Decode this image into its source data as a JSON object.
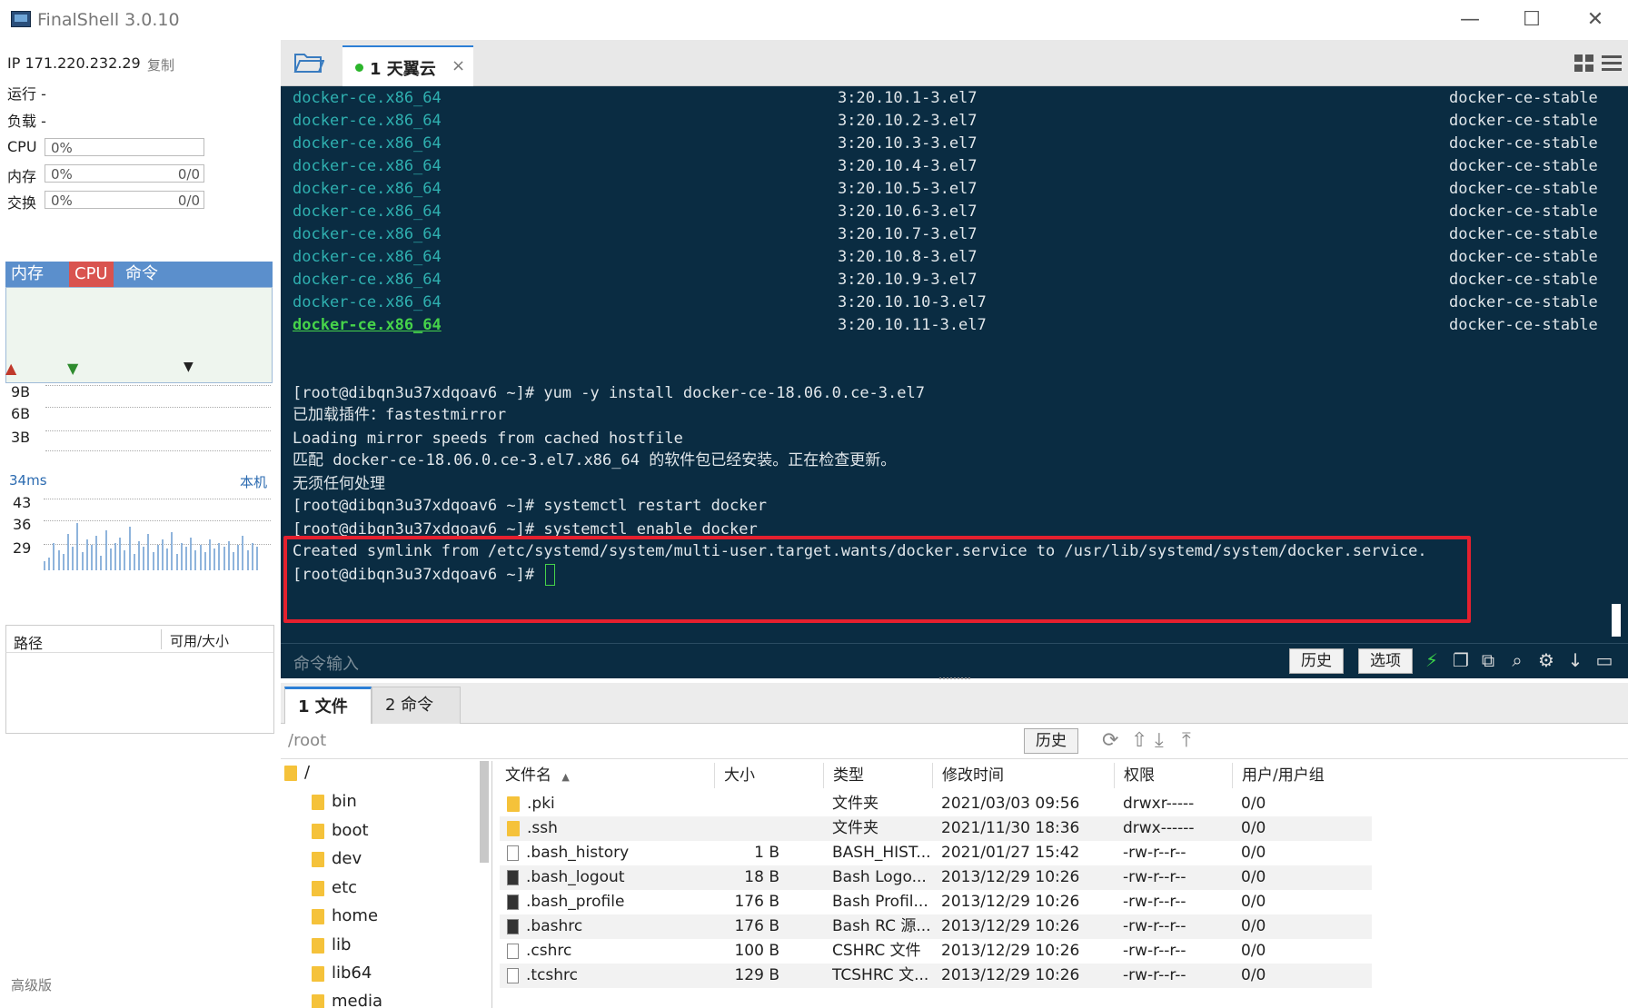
{
  "window": {
    "title": "FinalShell 3.0.10",
    "min": "—",
    "max": "☐",
    "close": "✕"
  },
  "sidebar": {
    "ip_label": "IP 171.220.232.29",
    "copy_label": "复制",
    "run_label": "运行 -",
    "load_label": "负载 -",
    "cpu_label": "CPU",
    "cpu_value": "0%",
    "mem_label": "内存",
    "mem_value": "0%",
    "mem_ratio": "0/0",
    "swap_label": "交换",
    "swap_value": "0%",
    "swap_ratio": "0/0",
    "monitor_tabs": [
      "内存",
      "CPU",
      "命令"
    ],
    "net_labels": [
      "9B",
      "6B",
      "3B"
    ],
    "ping_ms": "34ms",
    "ping_host": "本机",
    "ping_labels": [
      "43",
      "36",
      "29"
    ],
    "path_col": "路径",
    "avail_col": "可用/大小",
    "advanced": "高级版",
    "accent_colors": {
      "up": "#c0392b",
      "down": "#2e8b2e",
      "tab_bg": "#5b8fcc",
      "cpu_tab": "#d9534f"
    }
  },
  "session_tab": {
    "label": "1 天翼云",
    "status_color": "#2bb52b",
    "close": "×"
  },
  "terminal": {
    "packages": [
      {
        "name": "docker-ce.x86_64",
        "version": "3:20.10.1-3.el7",
        "repo": "docker-ce-stable"
      },
      {
        "name": "docker-ce.x86_64",
        "version": "3:20.10.2-3.el7",
        "repo": "docker-ce-stable"
      },
      {
        "name": "docker-ce.x86_64",
        "version": "3:20.10.3-3.el7",
        "repo": "docker-ce-stable"
      },
      {
        "name": "docker-ce.x86_64",
        "version": "3:20.10.4-3.el7",
        "repo": "docker-ce-stable"
      },
      {
        "name": "docker-ce.x86_64",
        "version": "3:20.10.5-3.el7",
        "repo": "docker-ce-stable"
      },
      {
        "name": "docker-ce.x86_64",
        "version": "3:20.10.6-3.el7",
        "repo": "docker-ce-stable"
      },
      {
        "name": "docker-ce.x86_64",
        "version": "3:20.10.7-3.el7",
        "repo": "docker-ce-stable"
      },
      {
        "name": "docker-ce.x86_64",
        "version": "3:20.10.8-3.el7",
        "repo": "docker-ce-stable"
      },
      {
        "name": "docker-ce.x86_64",
        "version": "3:20.10.9-3.el7",
        "repo": "docker-ce-stable"
      },
      {
        "name": "docker-ce.x86_64",
        "version": "3:20.10.10-3.el7",
        "repo": "docker-ce-stable"
      },
      {
        "name": "docker-ce.x86_64",
        "version": "3:20.10.11-3.el7",
        "repo": "docker-ce-stable"
      }
    ],
    "lines": [
      "[root@dibqn3u37xdqoav6 ~]# yum -y install docker-ce-18.06.0.ce-3.el7",
      "已加载插件：fastestmirror",
      "Loading mirror speeds from cached hostfile",
      "匹配 docker-ce-18.06.0.ce-3.el7.x86_64 的软件包已经安装。正在检查更新。",
      "无须任何处理",
      "[root@dibqn3u37xdqoav6 ~]# systemctl restart docker",
      "[root@dibqn3u37xdqoav6 ~]# systemctl enable docker",
      "Created symlink from /etc/systemd/system/multi-user.target.wants/docker.service to /usr/lib/systemd/system/docker.service.",
      "[root@dibqn3u37xdqoav6 ~]# "
    ],
    "cmd_placeholder": "命令输入",
    "history_btn": "历史",
    "options_btn": "选项",
    "highlight_color": "#e5202e"
  },
  "bottom_tabs": [
    "1 文件",
    "2 命令"
  ],
  "file_panel": {
    "path": "/root",
    "history_btn": "历史",
    "tree": [
      "/",
      "bin",
      "boot",
      "dev",
      "etc",
      "home",
      "lib",
      "lib64",
      "media"
    ],
    "columns": [
      "文件名",
      "大小",
      "类型",
      "修改时间",
      "权限",
      "用户/用户组"
    ],
    "sort_indicator": "▲",
    "files": [
      {
        "name": ".pki",
        "size": "",
        "type": "文件夹",
        "mtime": "2021/03/03 09:56",
        "perm": "drwxr-----",
        "owner": "0/0",
        "icon": "folder"
      },
      {
        "name": ".ssh",
        "size": "",
        "type": "文件夹",
        "mtime": "2021/11/30 18:36",
        "perm": "drwx------",
        "owner": "0/0",
        "icon": "folder"
      },
      {
        "name": ".bash_history",
        "size": "1 B",
        "type": "BASH_HIST...",
        "mtime": "2021/01/27 15:42",
        "perm": "-rw-r--r--",
        "owner": "0/0",
        "icon": "doc"
      },
      {
        "name": ".bash_logout",
        "size": "18 B",
        "type": "Bash Logo...",
        "mtime": "2013/12/29 10:26",
        "perm": "-rw-r--r--",
        "owner": "0/0",
        "icon": "doc-dark"
      },
      {
        "name": ".bash_profile",
        "size": "176 B",
        "type": "Bash Profil...",
        "mtime": "2013/12/29 10:26",
        "perm": "-rw-r--r--",
        "owner": "0/0",
        "icon": "doc-dark"
      },
      {
        "name": ".bashrc",
        "size": "176 B",
        "type": "Bash RC 源...",
        "mtime": "2013/12/29 10:26",
        "perm": "-rw-r--r--",
        "owner": "0/0",
        "icon": "doc-dark"
      },
      {
        "name": ".cshrc",
        "size": "100 B",
        "type": "CSHRC 文件",
        "mtime": "2013/12/29 10:26",
        "perm": "-rw-r--r--",
        "owner": "0/0",
        "icon": "doc"
      },
      {
        "name": ".tcshrc",
        "size": "129 B",
        "type": "TCSHRC 文...",
        "mtime": "2013/12/29 10:26",
        "perm": "-rw-r--r--",
        "owner": "0/0",
        "icon": "doc"
      }
    ]
  }
}
